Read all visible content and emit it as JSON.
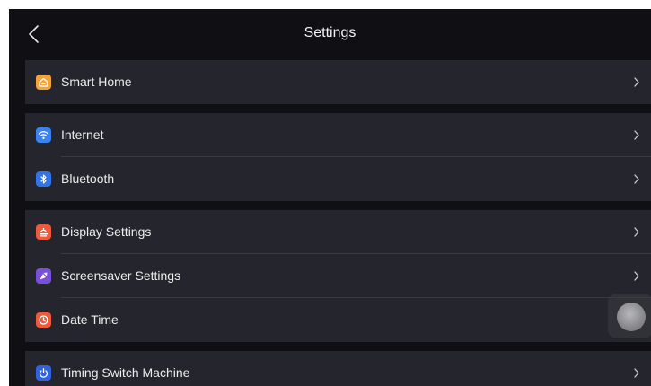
{
  "header": {
    "title": "Settings"
  },
  "groups": [
    {
      "items": [
        {
          "label": "Smart Home",
          "icon": "smart-home-icon",
          "color": "#f4a23a"
        }
      ]
    },
    {
      "items": [
        {
          "label": "Internet",
          "icon": "wifi-icon",
          "color": "#3b82f0"
        },
        {
          "label": "Bluetooth",
          "icon": "bluetooth-icon",
          "color": "#2f74e8"
        }
      ]
    },
    {
      "items": [
        {
          "label": "Display Settings",
          "icon": "display-icon",
          "color": "#ef5b3a"
        },
        {
          "label": "Screensaver Settings",
          "icon": "screensaver-icon",
          "color": "#7a4fd8"
        },
        {
          "label": "Date Time",
          "icon": "clock-icon",
          "color": "#f05a3c"
        }
      ]
    },
    {
      "items": [
        {
          "label": "Timing Switch Machine",
          "icon": "power-icon",
          "color": "#2f63e0"
        }
      ]
    }
  ],
  "colors": {
    "background": "#101014",
    "group_background": "#25262d",
    "text": "#ececec",
    "divider": "#3a3b42"
  }
}
